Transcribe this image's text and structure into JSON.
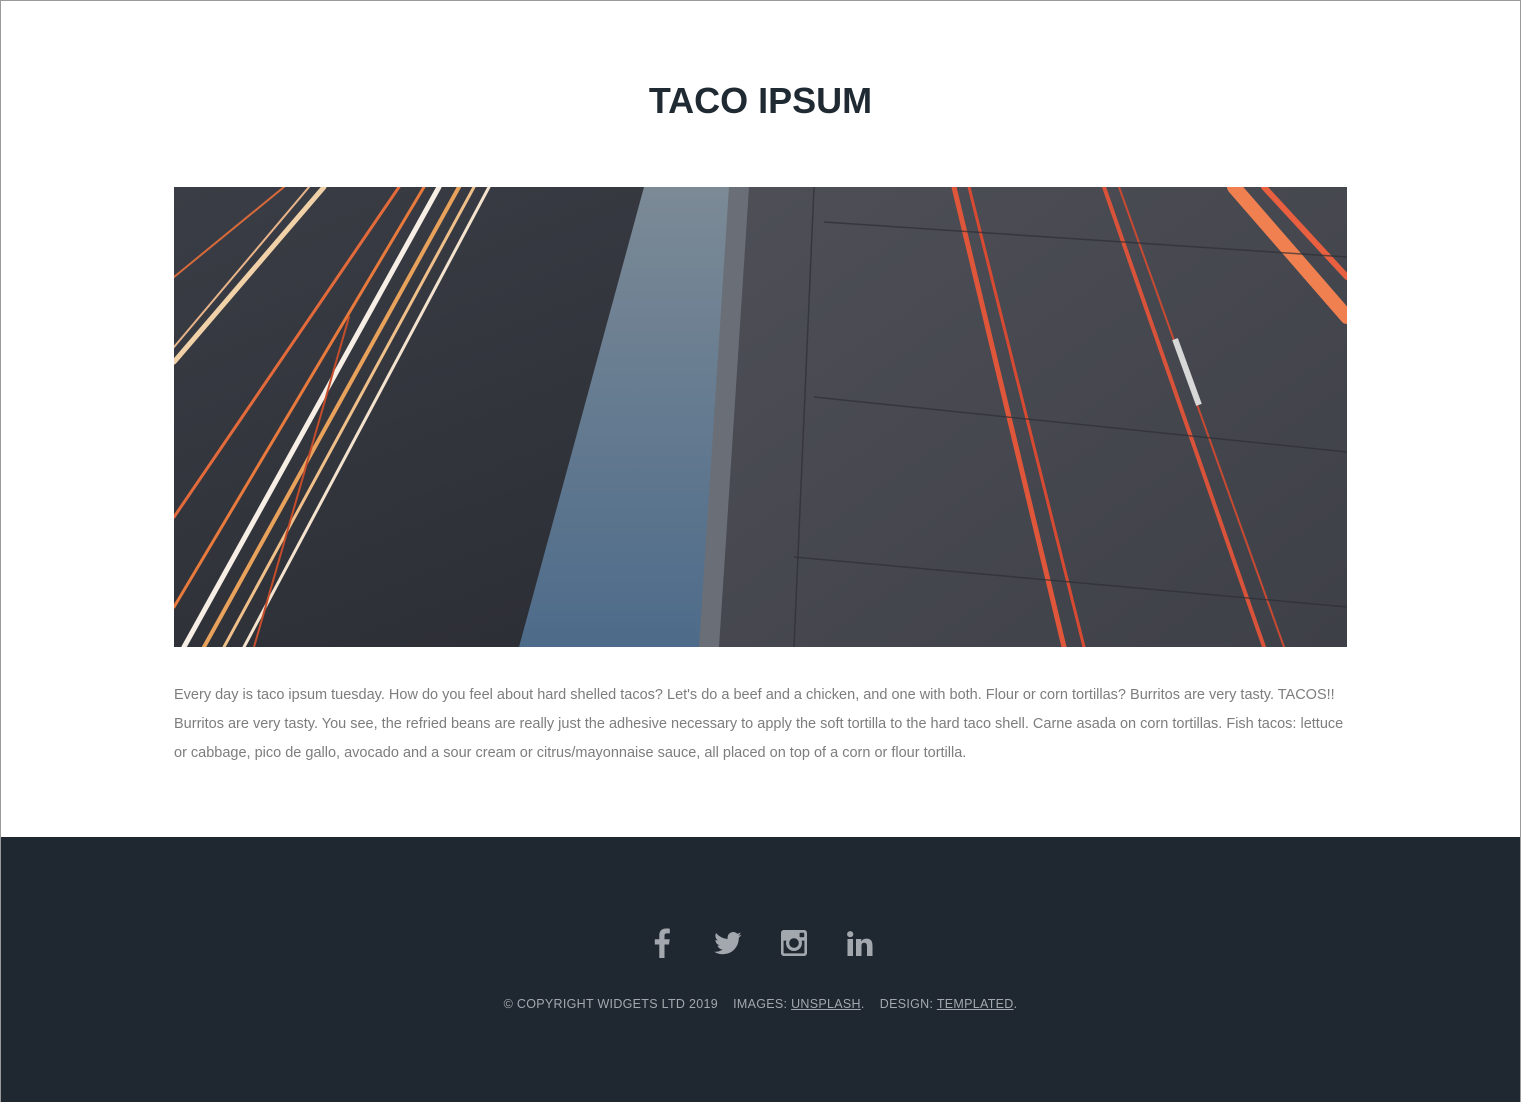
{
  "header": {
    "title": "TACO IPSUM"
  },
  "hero": {
    "image_alt": "Long-exposure photo of a highway with red and white light trails"
  },
  "article": {
    "body": "Every day is taco ipsum tuesday. How do you feel about hard shelled tacos? Let's do a beef and a chicken, and one with both. Flour or corn tortillas? Burritos are very tasty. TACOS!! Burritos are very tasty. You see, the refried beans are really just the adhesive necessary to apply the soft tortilla to the hard taco shell. Carne asada on corn tortillas. Fish tacos: lettuce or cabbage, pico de gallo, avocado and a sour cream or citrus/mayonnaise sauce, all placed on top of a corn or flour tortilla."
  },
  "footer": {
    "social": [
      {
        "name": "facebook-icon"
      },
      {
        "name": "twitter-icon"
      },
      {
        "name": "instagram-icon"
      },
      {
        "name": "linkedin-icon"
      }
    ],
    "copyright": "© COPYRIGHT WIDGETS LTD 2019",
    "images_label": "IMAGES: ",
    "images_link": "UNSPLASH",
    "design_label": "DESIGN: ",
    "design_link": "TEMPLATED"
  },
  "colors": {
    "title": "#1f2a33",
    "body_text": "#7d7d7d",
    "footer_bg": "#1f2731",
    "footer_text": "#a3a8ae"
  }
}
